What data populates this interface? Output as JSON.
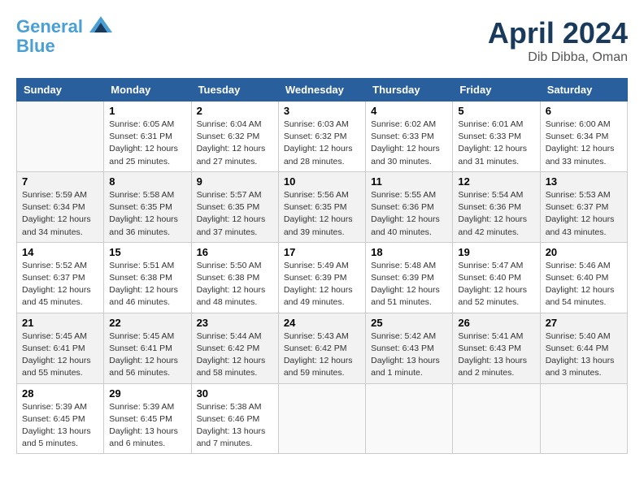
{
  "header": {
    "logo_line1": "General",
    "logo_line2": "Blue",
    "month": "April 2024",
    "location": "Dib Dibba, Oman"
  },
  "columns": [
    "Sunday",
    "Monday",
    "Tuesday",
    "Wednesday",
    "Thursday",
    "Friday",
    "Saturday"
  ],
  "weeks": [
    [
      {
        "day": "",
        "info": ""
      },
      {
        "day": "1",
        "info": "Sunrise: 6:05 AM\nSunset: 6:31 PM\nDaylight: 12 hours\nand 25 minutes."
      },
      {
        "day": "2",
        "info": "Sunrise: 6:04 AM\nSunset: 6:32 PM\nDaylight: 12 hours\nand 27 minutes."
      },
      {
        "day": "3",
        "info": "Sunrise: 6:03 AM\nSunset: 6:32 PM\nDaylight: 12 hours\nand 28 minutes."
      },
      {
        "day": "4",
        "info": "Sunrise: 6:02 AM\nSunset: 6:33 PM\nDaylight: 12 hours\nand 30 minutes."
      },
      {
        "day": "5",
        "info": "Sunrise: 6:01 AM\nSunset: 6:33 PM\nDaylight: 12 hours\nand 31 minutes."
      },
      {
        "day": "6",
        "info": "Sunrise: 6:00 AM\nSunset: 6:34 PM\nDaylight: 12 hours\nand 33 minutes."
      }
    ],
    [
      {
        "day": "7",
        "info": "Sunrise: 5:59 AM\nSunset: 6:34 PM\nDaylight: 12 hours\nand 34 minutes."
      },
      {
        "day": "8",
        "info": "Sunrise: 5:58 AM\nSunset: 6:35 PM\nDaylight: 12 hours\nand 36 minutes."
      },
      {
        "day": "9",
        "info": "Sunrise: 5:57 AM\nSunset: 6:35 PM\nDaylight: 12 hours\nand 37 minutes."
      },
      {
        "day": "10",
        "info": "Sunrise: 5:56 AM\nSunset: 6:35 PM\nDaylight: 12 hours\nand 39 minutes."
      },
      {
        "day": "11",
        "info": "Sunrise: 5:55 AM\nSunset: 6:36 PM\nDaylight: 12 hours\nand 40 minutes."
      },
      {
        "day": "12",
        "info": "Sunrise: 5:54 AM\nSunset: 6:36 PM\nDaylight: 12 hours\nand 42 minutes."
      },
      {
        "day": "13",
        "info": "Sunrise: 5:53 AM\nSunset: 6:37 PM\nDaylight: 12 hours\nand 43 minutes."
      }
    ],
    [
      {
        "day": "14",
        "info": "Sunrise: 5:52 AM\nSunset: 6:37 PM\nDaylight: 12 hours\nand 45 minutes."
      },
      {
        "day": "15",
        "info": "Sunrise: 5:51 AM\nSunset: 6:38 PM\nDaylight: 12 hours\nand 46 minutes."
      },
      {
        "day": "16",
        "info": "Sunrise: 5:50 AM\nSunset: 6:38 PM\nDaylight: 12 hours\nand 48 minutes."
      },
      {
        "day": "17",
        "info": "Sunrise: 5:49 AM\nSunset: 6:39 PM\nDaylight: 12 hours\nand 49 minutes."
      },
      {
        "day": "18",
        "info": "Sunrise: 5:48 AM\nSunset: 6:39 PM\nDaylight: 12 hours\nand 51 minutes."
      },
      {
        "day": "19",
        "info": "Sunrise: 5:47 AM\nSunset: 6:40 PM\nDaylight: 12 hours\nand 52 minutes."
      },
      {
        "day": "20",
        "info": "Sunrise: 5:46 AM\nSunset: 6:40 PM\nDaylight: 12 hours\nand 54 minutes."
      }
    ],
    [
      {
        "day": "21",
        "info": "Sunrise: 5:45 AM\nSunset: 6:41 PM\nDaylight: 12 hours\nand 55 minutes."
      },
      {
        "day": "22",
        "info": "Sunrise: 5:45 AM\nSunset: 6:41 PM\nDaylight: 12 hours\nand 56 minutes."
      },
      {
        "day": "23",
        "info": "Sunrise: 5:44 AM\nSunset: 6:42 PM\nDaylight: 12 hours\nand 58 minutes."
      },
      {
        "day": "24",
        "info": "Sunrise: 5:43 AM\nSunset: 6:42 PM\nDaylight: 12 hours\nand 59 minutes."
      },
      {
        "day": "25",
        "info": "Sunrise: 5:42 AM\nSunset: 6:43 PM\nDaylight: 13 hours\nand 1 minute."
      },
      {
        "day": "26",
        "info": "Sunrise: 5:41 AM\nSunset: 6:43 PM\nDaylight: 13 hours\nand 2 minutes."
      },
      {
        "day": "27",
        "info": "Sunrise: 5:40 AM\nSunset: 6:44 PM\nDaylight: 13 hours\nand 3 minutes."
      }
    ],
    [
      {
        "day": "28",
        "info": "Sunrise: 5:39 AM\nSunset: 6:45 PM\nDaylight: 13 hours\nand 5 minutes."
      },
      {
        "day": "29",
        "info": "Sunrise: 5:39 AM\nSunset: 6:45 PM\nDaylight: 13 hours\nand 6 minutes."
      },
      {
        "day": "30",
        "info": "Sunrise: 5:38 AM\nSunset: 6:46 PM\nDaylight: 13 hours\nand 7 minutes."
      },
      {
        "day": "",
        "info": ""
      },
      {
        "day": "",
        "info": ""
      },
      {
        "day": "",
        "info": ""
      },
      {
        "day": "",
        "info": ""
      }
    ]
  ]
}
